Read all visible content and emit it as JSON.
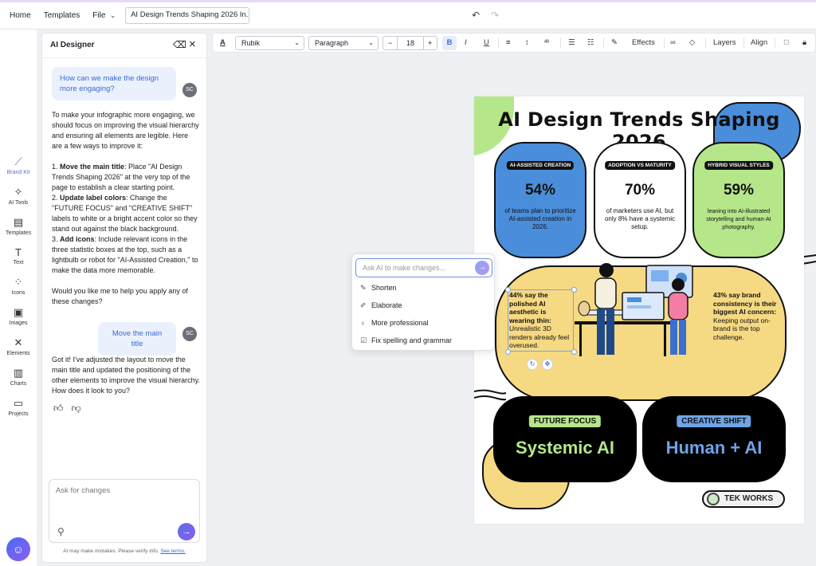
{
  "topbar": {
    "home": "Home",
    "templates": "Templates",
    "file": "File",
    "doc_title": "AI Design Trends Shaping 2026 In..."
  },
  "rail": {
    "items": [
      {
        "label": "Brand Kit",
        "icon": "brand-kit-icon"
      },
      {
        "label": "AI Tools",
        "icon": "ai-tools-icon"
      },
      {
        "label": "Templates",
        "icon": "templates-icon"
      },
      {
        "label": "Text",
        "icon": "text-icon"
      },
      {
        "label": "Icons",
        "icon": "icons-icon"
      },
      {
        "label": "Images",
        "icon": "images-icon"
      },
      {
        "label": "Elements",
        "icon": "elements-icon"
      },
      {
        "label": "Charts",
        "icon": "charts-icon"
      },
      {
        "label": "Projects",
        "icon": "projects-icon"
      }
    ],
    "accent": "#5b6ee1"
  },
  "panel": {
    "title": "AI Designer",
    "user_msg_1": "How can we make the design more engaging?",
    "avatar": "SC",
    "ai_intro": "To make your infographic more engaging, we should focus on improving the visual hierarchy and ensuring all elements are legible. Here are a few ways to improve it:",
    "tips": [
      {
        "lead": "1. ",
        "bold": "Move the main title",
        "rest": ": Place \"AI Design Trends Shaping 2026\" at the very top of the page to establish a clear starting point."
      },
      {
        "lead": "2. ",
        "bold": "Update label colors",
        "rest": ": Change the \"FUTURE FOCUS\" and \"CREATIVE SHIFT\" labels to white or a bright accent color so they stand out against the black background."
      },
      {
        "lead": "3. ",
        "bold": "Add icons",
        "rest": ": Include relevant icons in the three statistic boxes at the top, such as a lightbulb or robot for \"AI-Assisted Creation,\" to make the data more memorable."
      }
    ],
    "ai_question": "Would you like me to help you apply any of these changes?",
    "user_msg_2": "Move the main title",
    "ai_reply": "Got it! I've adjusted the layout to move the main title and updated the positioning of the other elements to improve the visual hierarchy. How does it look to you?",
    "input_placeholder": "Ask for changes",
    "disclaimer": "AI may make mistakes. Please verify info.",
    "terms": "See terms."
  },
  "toolbar": {
    "font": "Rubik",
    "style": "Paragraph",
    "size": "18",
    "minus": "−",
    "plus": "+",
    "bold": "B",
    "italic": "I",
    "underline": "U",
    "effects": "Effects",
    "layers": "Layers",
    "align": "Align"
  },
  "popup": {
    "placeholder": "Ask AI to make changes...",
    "items": [
      "Shorten",
      "Elaborate",
      "More professional",
      "Fix spelling and grammar"
    ]
  },
  "infographic": {
    "title": "AI Design Trends Shaping 2026",
    "stats": [
      {
        "tag": "AI-ASSISTED CREATION",
        "value": "54%",
        "desc": "of teams plan to prioritize AI-assisted creation in 2026.",
        "color": "#4a8edb"
      },
      {
        "tag": "ADOPTION VS MATURITY",
        "value": "70%",
        "desc": "of marketers use AI, but only 8% have a systemic setup.",
        "color": "#ffffff"
      },
      {
        "tag": "HYBRID VISUAL STYLES",
        "value": "59%",
        "desc": "leaning into AI-illustrated storytelling and human-AI photography.",
        "color": "#b6e68a"
      }
    ],
    "mid_left_bold": "44% say the polished AI aesthetic is wearing thin:",
    "mid_left_rest": "Unrealistic 3D renders already feel overused.",
    "mid_right_bold": "43% say brand consistency is their biggest AI concern:",
    "mid_right_rest": "Keeping output on-brand is the top challenge.",
    "cards": [
      {
        "tag": "FUTURE FOCUS",
        "big": "Systemic AI",
        "tag_bg": "#b6e68a",
        "big_color": "#b6e68a"
      },
      {
        "tag": "CREATIVE SHIFT",
        "big": "Human + AI",
        "tag_bg": "#6fa4e8",
        "big_color": "#6fa4e8"
      }
    ],
    "logo": "TEK WORKS"
  }
}
